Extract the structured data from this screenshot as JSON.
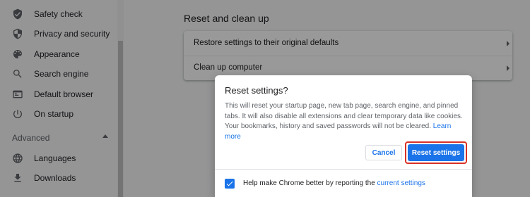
{
  "sidebar": {
    "items": [
      {
        "label": "Safety check",
        "icon": "shield-check-icon"
      },
      {
        "label": "Privacy and security",
        "icon": "shield-icon"
      },
      {
        "label": "Appearance",
        "icon": "palette-icon"
      },
      {
        "label": "Search engine",
        "icon": "search-icon"
      },
      {
        "label": "Default browser",
        "icon": "browser-icon"
      },
      {
        "label": "On startup",
        "icon": "power-icon"
      }
    ],
    "advanced_label": "Advanced",
    "advanced_items": [
      {
        "label": "Languages",
        "icon": "globe-icon"
      },
      {
        "label": "Downloads",
        "icon": "download-icon"
      }
    ]
  },
  "main": {
    "section_title": "Reset and clean up",
    "rows": [
      {
        "label": "Restore settings to their original defaults"
      },
      {
        "label": "Clean up computer"
      }
    ]
  },
  "dialog": {
    "title": "Reset settings?",
    "body": "This will reset your startup page, new tab page, search engine, and pinned tabs. It will also disable all extensions and clear temporary data like cookies. Your bookmarks, history and saved passwords will not be cleared.",
    "learn_more": "Learn more",
    "cancel_label": "Cancel",
    "reset_label": "Reset settings",
    "footer_text": "Help make Chrome better by reporting the",
    "footer_link": "current settings",
    "report_checked": true
  },
  "colors": {
    "accent": "#1a73e8",
    "highlight": "#d93025"
  }
}
